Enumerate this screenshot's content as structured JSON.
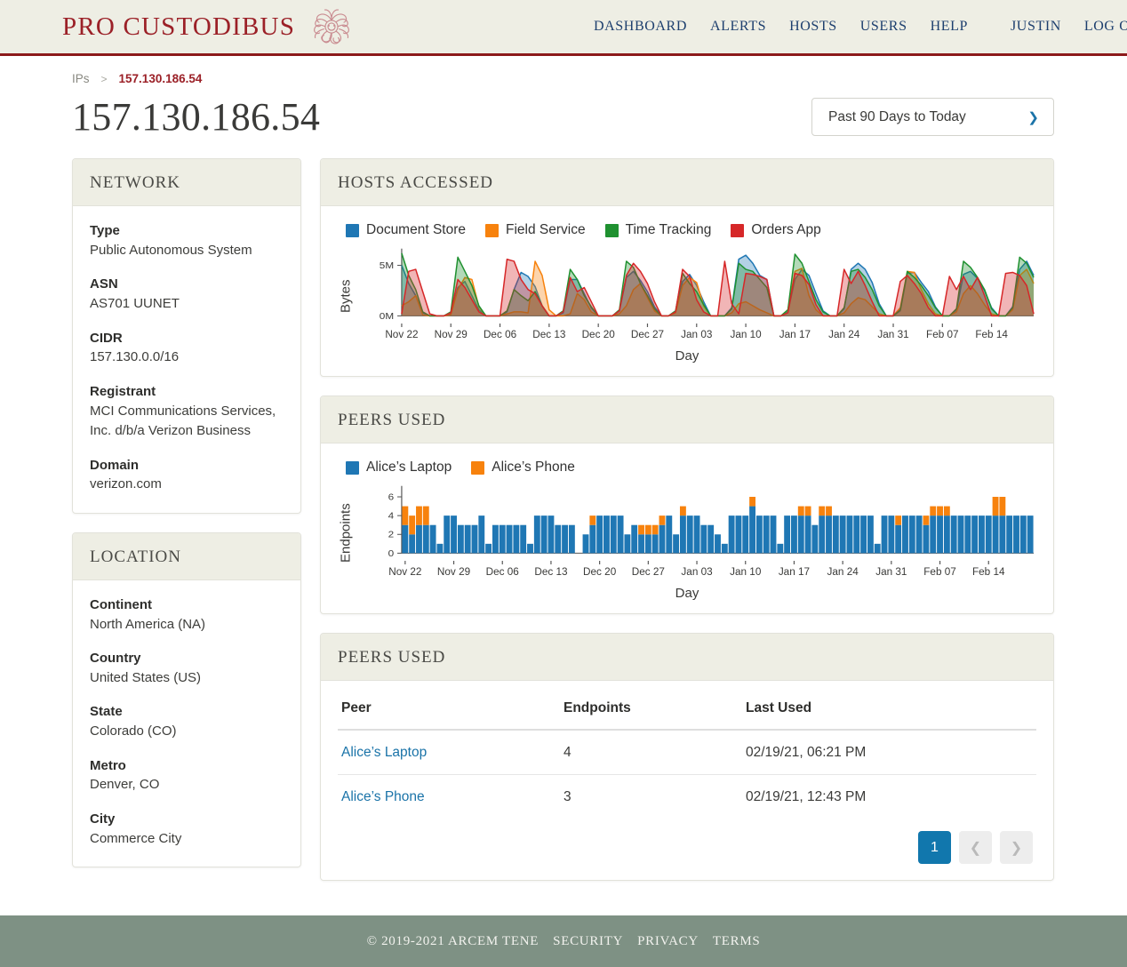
{
  "header": {
    "brand": "PRO CUSTODIBUS",
    "logo_icon": "medusa-head-icon",
    "nav": [
      {
        "label": "DASHBOARD"
      },
      {
        "label": "ALERTS"
      },
      {
        "label": "HOSTS"
      },
      {
        "label": "USERS"
      },
      {
        "label": "HELP"
      }
    ],
    "user": "JUSTIN",
    "logout": "LOG OUT"
  },
  "breadcrumb": {
    "root": "IPs",
    "separator": ">",
    "current": "157.130.186.54"
  },
  "page": {
    "title": "157.130.186.54",
    "date_range": "Past 90 Days to Today",
    "date_range_icon": "chevron-down-icon"
  },
  "network": {
    "heading": "NETWORK",
    "fields": [
      {
        "term": "Type",
        "value": "Public Autonomous System"
      },
      {
        "term": "ASN",
        "value": "AS701 UUNET"
      },
      {
        "term": "CIDR",
        "value": "157.130.0.0/16"
      },
      {
        "term": "Registrant",
        "value": "MCI Communications Services, Inc. d/b/a Verizon Business"
      },
      {
        "term": "Domain",
        "value": "verizon.com"
      }
    ]
  },
  "location": {
    "heading": "LOCATION",
    "fields": [
      {
        "term": "Continent",
        "value": "North America (NA)"
      },
      {
        "term": "Country",
        "value": "United States (US)"
      },
      {
        "term": "State",
        "value": "Colorado (CO)"
      },
      {
        "term": "Metro",
        "value": "Denver, CO"
      },
      {
        "term": "City",
        "value": "Commerce City"
      }
    ]
  },
  "hosts_accessed": {
    "heading": "HOSTS ACCESSED"
  },
  "peers_used_chart": {
    "heading": "PEERS USED"
  },
  "peers_used_table": {
    "heading": "PEERS USED",
    "columns": [
      "Peer",
      "Endpoints",
      "Last Used"
    ],
    "rows": [
      {
        "peer": "Alice’s Laptop",
        "endpoints": "4",
        "last_used": "02/19/21, 06:21 PM"
      },
      {
        "peer": "Alice’s Phone",
        "endpoints": "3",
        "last_used": "02/19/21, 12:43 PM"
      }
    ],
    "pagination": {
      "current_page": "1",
      "prev_icon": "chevron-left-icon",
      "next_icon": "chevron-right-icon"
    }
  },
  "footer": {
    "copyright": "© 2019-2021 ARCEM TENE",
    "links": [
      "SECURITY",
      "PRIVACY",
      "TERMS"
    ]
  },
  "colors": {
    "brand_red": "#9b2027",
    "nav_blue": "#1d3f6e",
    "link_blue": "#1a73a8",
    "panel_bg": "#eeeee4",
    "footer_bg": "#7e9184",
    "series_blue": "#1f77b4",
    "series_orange": "#f7820d",
    "series_green": "#1f9130",
    "series_red": "#d62728"
  },
  "chart_data": [
    {
      "type": "area",
      "name": "hosts-accessed",
      "title": "HOSTS ACCESSED",
      "xlabel": "Day",
      "ylabel": "Bytes",
      "ylim": [
        0,
        6500000
      ],
      "yticks": [
        0,
        5000000
      ],
      "ytick_labels": [
        "0M",
        "5M"
      ],
      "grid": false,
      "legend_position": "top-left",
      "xtick_labels": [
        "Nov 22",
        "Nov 29",
        "Dec 06",
        "Dec 13",
        "Dec 20",
        "Dec 27",
        "Jan 03",
        "Jan 10",
        "Jan 17",
        "Jan 24",
        "Jan 31",
        "Feb 07",
        "Feb 14"
      ],
      "x_count": 91,
      "series": [
        {
          "name": "Document Store",
          "color": "#1f77b4",
          "values": [
            5.0,
            3.2,
            2.0,
            0.3,
            0.0,
            0.0,
            0.0,
            0.2,
            2.8,
            3.4,
            2.0,
            0.6,
            0.0,
            0.0,
            0.0,
            0.4,
            2.6,
            4.3,
            3.9,
            2.9,
            1.0,
            0.0,
            0.0,
            0.3,
            3.6,
            3.6,
            2.2,
            0.8,
            0.0,
            0.0,
            0.0,
            0.5,
            3.8,
            4.4,
            3.5,
            2.4,
            0.9,
            0.0,
            0.0,
            0.4,
            3.4,
            4.1,
            3.0,
            1.4,
            0.0,
            0.0,
            0.0,
            0.8,
            5.6,
            6.0,
            5.2,
            4.0,
            3.6,
            0.0,
            0.0,
            0.4,
            3.6,
            4.6,
            4.0,
            2.2,
            0.5,
            0.0,
            0.0,
            0.7,
            4.6,
            5.2,
            4.6,
            3.3,
            1.2,
            0.0,
            0.0,
            0.5,
            4.2,
            4.3,
            3.3,
            2.4,
            0.9,
            0.0,
            0.0,
            0.6,
            4.1,
            4.4,
            3.7,
            2.5,
            0.8,
            0.0,
            0.0,
            0.9,
            4.6,
            5.4,
            4.0
          ]
        },
        {
          "name": "Field Service",
          "color": "#f7820d",
          "values": [
            1.0,
            1.4,
            2.0,
            0.1,
            0.0,
            0.0,
            0.0,
            0.1,
            2.6,
            3.8,
            3.6,
            0.9,
            0.0,
            0.0,
            0.0,
            0.2,
            0.4,
            0.4,
            0.3,
            5.4,
            4.0,
            0.6,
            0.0,
            0.0,
            0.2,
            2.2,
            1.6,
            0.4,
            0.0,
            0.0,
            0.0,
            0.2,
            1.0,
            2.6,
            3.2,
            1.8,
            0.5,
            0.0,
            0.0,
            0.3,
            3.0,
            3.8,
            3.3,
            1.0,
            0.0,
            0.0,
            0.0,
            0.3,
            1.2,
            1.4,
            1.0,
            0.6,
            0.3,
            0.0,
            0.0,
            0.6,
            4.4,
            4.7,
            2.0,
            0.6,
            0.0,
            0.0,
            0.0,
            0.3,
            1.2,
            1.8,
            1.6,
            0.9,
            0.2,
            0.0,
            0.0,
            0.8,
            4.4,
            4.3,
            2.6,
            1.2,
            0.2,
            0.0,
            0.0,
            0.4,
            2.2,
            3.0,
            2.2,
            1.1,
            0.2,
            0.0,
            0.0,
            0.6,
            4.0,
            4.6,
            3.2
          ]
        },
        {
          "name": "Time Tracking",
          "color": "#1f9130",
          "values": [
            6.2,
            4.0,
            2.6,
            0.4,
            0.0,
            0.0,
            0.0,
            0.4,
            5.8,
            4.4,
            3.0,
            1.0,
            0.0,
            0.0,
            0.0,
            0.5,
            2.6,
            2.0,
            1.5,
            2.4,
            1.0,
            0.0,
            0.0,
            0.5,
            4.6,
            3.6,
            2.0,
            0.9,
            0.0,
            0.0,
            0.0,
            0.6,
            5.4,
            4.8,
            3.2,
            2.0,
            0.7,
            0.0,
            0.0,
            0.5,
            4.2,
            3.2,
            2.4,
            1.1,
            0.0,
            0.0,
            0.0,
            0.7,
            5.2,
            4.6,
            4.4,
            3.6,
            2.8,
            0.0,
            0.0,
            0.6,
            6.1,
            5.2,
            3.4,
            1.6,
            0.4,
            0.0,
            0.0,
            0.8,
            4.4,
            4.6,
            3.8,
            2.6,
            1.0,
            0.0,
            0.0,
            0.6,
            4.4,
            3.8,
            3.0,
            2.0,
            0.8,
            0.0,
            0.0,
            0.7,
            5.4,
            4.8,
            3.8,
            2.6,
            0.7,
            0.0,
            0.0,
            0.8,
            5.8,
            5.2,
            3.8
          ]
        },
        {
          "name": "Orders App",
          "color": "#d62728",
          "values": [
            0.2,
            4.4,
            4.6,
            2.4,
            0.2,
            0.0,
            0.0,
            0.3,
            3.6,
            2.8,
            1.6,
            0.4,
            0.0,
            0.0,
            0.0,
            5.6,
            5.4,
            3.6,
            2.6,
            2.2,
            1.0,
            0.0,
            0.0,
            0.4,
            3.8,
            2.4,
            2.8,
            1.4,
            0.0,
            0.0,
            0.0,
            0.5,
            4.0,
            5.2,
            4.4,
            3.2,
            1.4,
            0.0,
            0.0,
            0.4,
            4.6,
            3.9,
            1.6,
            0.4,
            0.0,
            0.0,
            5.4,
            1.2,
            0.2,
            4.2,
            4.1,
            3.9,
            3.6,
            0.0,
            0.0,
            0.3,
            4.2,
            4.0,
            3.1,
            1.1,
            0.0,
            0.0,
            0.0,
            4.6,
            3.2,
            4.4,
            3.0,
            1.4,
            0.0,
            0.0,
            0.0,
            3.4,
            4.0,
            3.2,
            2.2,
            0.8,
            0.0,
            0.0,
            3.9,
            2.6,
            3.9,
            2.6,
            3.8,
            2.0,
            0.0,
            0.0,
            4.2,
            4.3,
            4.0,
            3.0,
            0.2
          ]
        }
      ]
    },
    {
      "type": "bar",
      "name": "peers-used",
      "title": "PEERS USED",
      "xlabel": "Day",
      "ylabel": "Endpoints",
      "ylim": [
        0,
        7
      ],
      "yticks": [
        0,
        2,
        4,
        6
      ],
      "ytick_labels": [
        "0",
        "2",
        "4",
        "6"
      ],
      "stacked": true,
      "grid": false,
      "legend_position": "top-left",
      "xtick_labels": [
        "Nov 22",
        "Nov 29",
        "Dec 06",
        "Dec 13",
        "Dec 20",
        "Dec 27",
        "Jan 03",
        "Jan 10",
        "Jan 17",
        "Jan 24",
        "Jan 31",
        "Feb 07",
        "Feb 14"
      ],
      "x_count": 91,
      "series": [
        {
          "name": "Alice’s Laptop",
          "color": "#1f77b4",
          "values": [
            3,
            2,
            3,
            3,
            3,
            1,
            4,
            4,
            3,
            3,
            3,
            4,
            1,
            3,
            3,
            3,
            3,
            3,
            1,
            4,
            4,
            4,
            3,
            3,
            3,
            0,
            2,
            3,
            4,
            4,
            4,
            4,
            2,
            3,
            2,
            2,
            2,
            3,
            4,
            2,
            4,
            4,
            4,
            3,
            3,
            2,
            1,
            4,
            4,
            4,
            5,
            4,
            4,
            4,
            1,
            4,
            4,
            4,
            4,
            3,
            4,
            4,
            4,
            4,
            4,
            4,
            4,
            4,
            1,
            4,
            4,
            3,
            4,
            4,
            4,
            3,
            4,
            4,
            4,
            4,
            4,
            4,
            4,
            4,
            4,
            4,
            4,
            4,
            4,
            4,
            4
          ]
        },
        {
          "name": "Alice’s Phone",
          "color": "#f7820d",
          "values": [
            2,
            2,
            2,
            2,
            0,
            0,
            0,
            0,
            0,
            0,
            0,
            0,
            0,
            0,
            0,
            0,
            0,
            0,
            0,
            0,
            0,
            0,
            0,
            0,
            0,
            0,
            0,
            1,
            0,
            0,
            0,
            0,
            0,
            0,
            1,
            1,
            1,
            1,
            0,
            0,
            1,
            0,
            0,
            0,
            0,
            0,
            0,
            0,
            0,
            0,
            1,
            0,
            0,
            0,
            0,
            0,
            0,
            1,
            1,
            0,
            1,
            1,
            0,
            0,
            0,
            0,
            0,
            0,
            0,
            0,
            0,
            1,
            0,
            0,
            0,
            1,
            1,
            1,
            1,
            0,
            0,
            0,
            0,
            0,
            0,
            2,
            2,
            0,
            0,
            0,
            0
          ]
        }
      ]
    }
  ]
}
